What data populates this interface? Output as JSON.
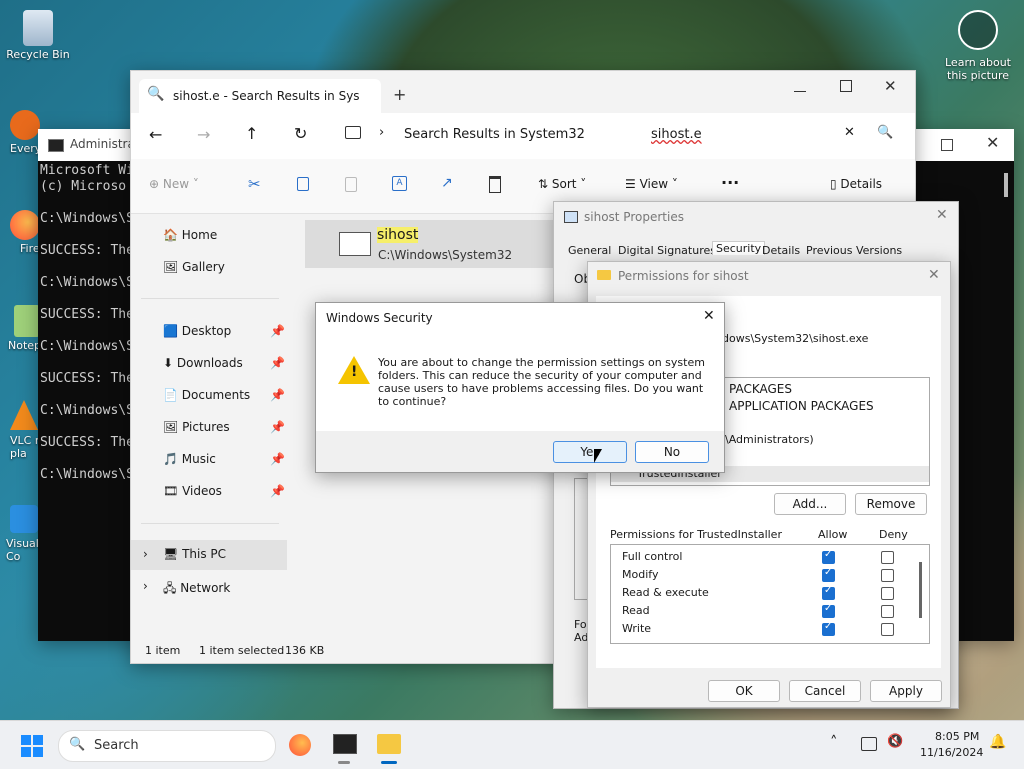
{
  "desktop": {
    "icons": [
      {
        "label": "Recycle Bin"
      },
      {
        "label": "Every"
      },
      {
        "label": "Fire"
      },
      {
        "label": "Notep"
      },
      {
        "label": "VLC r pla"
      },
      {
        "label": "Visual Co"
      }
    ],
    "learn_about": "Learn about this picture"
  },
  "cmd": {
    "title": "Administrator",
    "lines": [
      "Microsoft Wi",
      "(c) Microso",
      "",
      "C:\\Windows\\S",
      "",
      "SUCCESS: The",
      "",
      "C:\\Windows\\S",
      "",
      "SUCCESS: The",
      "",
      "C:\\Windows\\S",
      "",
      "SUCCESS: The",
      "",
      "C:\\Windows\\S",
      "",
      "SUCCESS: The",
      "",
      "C:\\Windows\\S"
    ]
  },
  "explorer": {
    "tab_title": "sihost.e - Search Results in Sys",
    "address": "Search Results in System32",
    "search_value": "sihost.e",
    "toolbar": {
      "new": "New",
      "sort": "Sort",
      "view": "View",
      "details": "Details"
    },
    "nav": {
      "home": "Home",
      "gallery": "Gallery",
      "desktop": "Desktop",
      "downloads": "Downloads",
      "documents": "Documents",
      "pictures": "Pictures",
      "music": "Music",
      "videos": "Videos",
      "this_pc": "This PC",
      "network": "Network"
    },
    "file": {
      "name": "sihost",
      "path": "C:\\Windows\\System32"
    },
    "status": {
      "count": "1 item",
      "selected": "1 item selected",
      "size": "136 KB"
    }
  },
  "properties": {
    "title": "sihost Properties",
    "tabs": [
      "General",
      "Digital Signatures",
      "Security",
      "Details",
      "Previous Versions"
    ],
    "obj_prefix": "Ob",
    "for_prefix": "Fo",
    "adv_prefix": "Ad"
  },
  "permissions": {
    "title": "Permissions for sihost",
    "object_path": "dows\\System32\\sihost.exe",
    "principals": [
      "PACKAGES",
      "APPLICATION PACKAGES",
      "\\Administrators)",
      "TrustedInstaller"
    ],
    "add": "Add...",
    "remove": "Remove",
    "perm_header": "Permissions for TrustedInstaller",
    "allow": "Allow",
    "deny": "Deny",
    "rows": [
      {
        "name": "Full control",
        "allow": true,
        "deny": false
      },
      {
        "name": "Modify",
        "allow": true,
        "deny": false
      },
      {
        "name": "Read & execute",
        "allow": true,
        "deny": false
      },
      {
        "name": "Read",
        "allow": true,
        "deny": false
      },
      {
        "name": "Write",
        "allow": true,
        "deny": false
      }
    ],
    "ok": "OK",
    "cancel": "Cancel",
    "apply": "Apply"
  },
  "security_dialog": {
    "title": "Windows Security",
    "message": "You are about to change the permission settings on system folders. This can reduce the security of your computer and cause users to have problems accessing files. Do you want to continue?",
    "yes": "Yes",
    "no": "No"
  },
  "taskbar": {
    "search": "Search",
    "time": "8:05 PM",
    "date": "11/16/2024"
  }
}
